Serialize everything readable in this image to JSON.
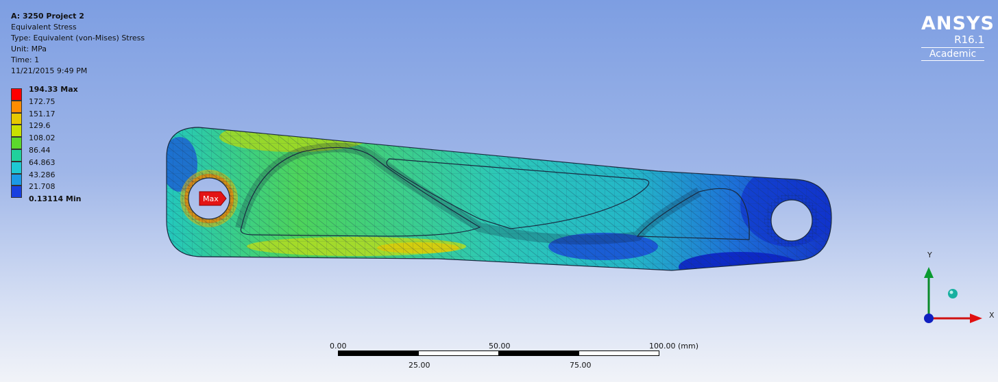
{
  "info": {
    "title": "A: 3250 Project 2",
    "result": "Equivalent Stress",
    "type": "Type: Equivalent (von-Mises) Stress",
    "unit": "Unit: MPa",
    "time": "Time: 1",
    "date": "11/21/2015 9:49 PM"
  },
  "legend": {
    "entries": [
      {
        "label": "194.33 Max",
        "color": "#ff0000"
      },
      {
        "label": "172.75",
        "color": "#ff8c00"
      },
      {
        "label": "151.17",
        "color": "#e6c800"
      },
      {
        "label": "129.6",
        "color": "#c8e000"
      },
      {
        "label": "108.02",
        "color": "#5cd82c"
      },
      {
        "label": "86.44",
        "color": "#20d09c"
      },
      {
        "label": "64.863",
        "color": "#1ec8d2"
      },
      {
        "label": "43.286",
        "color": "#1b9ae6"
      },
      {
        "label": "21.708",
        "color": "#1840e0"
      },
      {
        "label": "0.13114 Min",
        "color": "#0000cc"
      }
    ]
  },
  "logo": {
    "name": "ANSYS",
    "version": "R16.1",
    "edition": "Academic"
  },
  "probe": {
    "label": "Max"
  },
  "scale": {
    "top": [
      "0.00",
      "50.00",
      "100.00 (mm)"
    ],
    "bottom": [
      "25.00",
      "75.00"
    ]
  },
  "triad": {
    "x": "X",
    "y": "Y"
  }
}
